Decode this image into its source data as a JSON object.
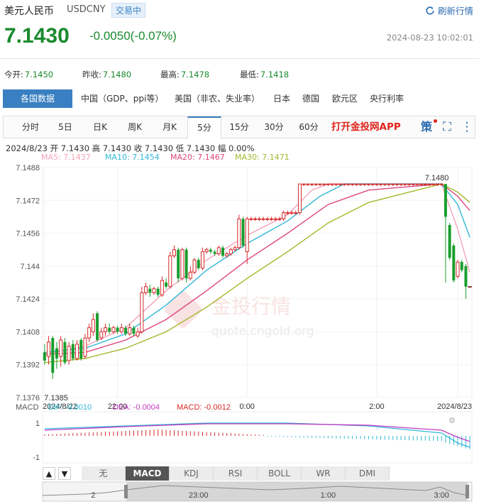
{
  "header": {
    "name": "美元人民币",
    "code": "USDCNY",
    "badge": "交易中",
    "refresh_label": "刷新行情",
    "price": "7.1430",
    "change": "-0.0050(-0.07%)",
    "time": "2024-08-23 10:02:01"
  },
  "stats": [
    {
      "label": "今开:",
      "value": "7.1450"
    },
    {
      "label": "昨收:",
      "value": "7.1480"
    },
    {
      "label": "最高:",
      "value": "7.1478"
    },
    {
      "label": "最低:",
      "value": "7.1418"
    }
  ],
  "categories": [
    "各国数据",
    "中国（GDP、ppi等）",
    "美国（非农、失业率）",
    "日本",
    "德国",
    "欧元区",
    "央行利率"
  ],
  "periods": [
    "分时",
    "5日",
    "日K",
    "周K",
    "月K",
    "5分",
    "15分",
    "30分",
    "60分"
  ],
  "active_period": "5分",
  "app_link": "打开金投网APP",
  "tools": {
    "ce": "策",
    "fullscreen": "⛶",
    "more": "⋮"
  },
  "bar_info": "2024/8/23  开 7.1430  高 7.1430  收 7.1430  低 7.1430  幅 0.00%",
  "ma_info": [
    {
      "label": "MA5: 7.1437",
      "color": "#f4a3b8"
    },
    {
      "label": "MA10: 7.1454",
      "color": "#2fb8d6"
    },
    {
      "label": "MA20: 7.1467",
      "color": "#e0457f"
    },
    {
      "label": "MA30: 7.1471",
      "color": "#a4b82a"
    }
  ],
  "watermark": {
    "brand": "金投行情",
    "url": "quote.cngold.org"
  },
  "colors": {
    "up": "#d42a2a",
    "down": "#1a9e2e",
    "accent": "#3a7fc1"
  },
  "chart_data": {
    "type": "candlestick",
    "y_ticks": [
      "7.1488",
      "7.1472",
      "7.1456",
      "7.144",
      "7.1424",
      "7.1408",
      "7.1392",
      "7.1376"
    ],
    "ylim": [
      7.1376,
      7.1488
    ],
    "x_ticks": [
      {
        "label": "2024/8/22",
        "index": 0
      },
      {
        "label": "22:00",
        "index": 18
      },
      {
        "label": "0:00",
        "index": 50
      },
      {
        "label": "2:00",
        "index": 82
      },
      {
        "label": "2024/8/23",
        "index": 102
      }
    ],
    "max_label": "7.1480",
    "min_label": "7.1385",
    "candles": [
      {
        "i": 0,
        "o": 7.1398,
        "c": 7.1394,
        "h": 7.1402,
        "l": 7.1392
      },
      {
        "i": 1,
        "o": 7.1396,
        "c": 7.1403,
        "h": 7.1406,
        "l": 7.1392
      },
      {
        "i": 2,
        "o": 7.1405,
        "c": 7.1388,
        "h": 7.1406,
        "l": 7.1385
      },
      {
        "i": 3,
        "o": 7.14,
        "c": 7.1395,
        "h": 7.1403,
        "l": 7.139
      },
      {
        "i": 4,
        "o": 7.1396,
        "c": 7.1404,
        "h": 7.1406,
        "l": 7.1391
      },
      {
        "i": 5,
        "o": 7.1403,
        "c": 7.1393,
        "h": 7.1405,
        "l": 7.1392
      },
      {
        "i": 6,
        "o": 7.1394,
        "c": 7.1401,
        "h": 7.1403,
        "l": 7.1392
      },
      {
        "i": 7,
        "o": 7.1402,
        "c": 7.1395,
        "h": 7.1404,
        "l": 7.1394
      },
      {
        "i": 8,
        "o": 7.1395,
        "c": 7.1402,
        "h": 7.1404,
        "l": 7.1394
      },
      {
        "i": 9,
        "o": 7.1404,
        "c": 7.1395,
        "h": 7.1405,
        "l": 7.1394
      },
      {
        "i": 10,
        "o": 7.1396,
        "c": 7.1405,
        "h": 7.1407,
        "l": 7.1395
      },
      {
        "i": 11,
        "o": 7.1405,
        "c": 7.141,
        "h": 7.1412,
        "l": 7.1403
      },
      {
        "i": 12,
        "o": 7.1408,
        "c": 7.1414,
        "h": 7.1417,
        "l": 7.1406
      },
      {
        "i": 13,
        "o": 7.1417,
        "c": 7.1404,
        "h": 7.1418,
        "l": 7.1403
      },
      {
        "i": 14,
        "o": 7.1405,
        "c": 7.1408,
        "h": 7.141,
        "l": 7.1404
      },
      {
        "i": 15,
        "o": 7.1408,
        "c": 7.141,
        "h": 7.1412,
        "l": 7.1406
      },
      {
        "i": 16,
        "o": 7.141,
        "c": 7.1408,
        "h": 7.1412,
        "l": 7.1407
      },
      {
        "i": 17,
        "o": 7.1408,
        "c": 7.141,
        "h": 7.1411,
        "l": 7.1407
      },
      {
        "i": 18,
        "o": 7.141,
        "c": 7.1408,
        "h": 7.1411,
        "l": 7.1407
      },
      {
        "i": 19,
        "o": 7.1408,
        "c": 7.141,
        "h": 7.1412,
        "l": 7.1407
      },
      {
        "i": 20,
        "o": 7.141,
        "c": 7.1407,
        "h": 7.1411,
        "l": 7.1406
      },
      {
        "i": 21,
        "o": 7.1407,
        "c": 7.141,
        "h": 7.1412,
        "l": 7.1406
      },
      {
        "i": 22,
        "o": 7.141,
        "c": 7.1407,
        "h": 7.1411,
        "l": 7.1406
      },
      {
        "i": 23,
        "o": 7.1406,
        "c": 7.1408,
        "h": 7.141,
        "l": 7.1405
      },
      {
        "i": 24,
        "o": 7.1408,
        "c": 7.1427,
        "h": 7.143,
        "l": 7.1407
      },
      {
        "i": 25,
        "o": 7.1427,
        "c": 7.143,
        "h": 7.1432,
        "l": 7.1426
      },
      {
        "i": 26,
        "o": 7.1429,
        "c": 7.1427,
        "h": 7.1431,
        "l": 7.1425
      },
      {
        "i": 27,
        "o": 7.1427,
        "c": 7.1429,
        "h": 7.143,
        "l": 7.1426
      },
      {
        "i": 28,
        "o": 7.1429,
        "c": 7.1426,
        "h": 7.143,
        "l": 7.1425
      },
      {
        "i": 29,
        "o": 7.1426,
        "c": 7.1433,
        "h": 7.1435,
        "l": 7.1425
      },
      {
        "i": 30,
        "o": 7.1432,
        "c": 7.143,
        "h": 7.1434,
        "l": 7.1429
      },
      {
        "i": 31,
        "o": 7.143,
        "c": 7.1445,
        "h": 7.1447,
        "l": 7.1429
      },
      {
        "i": 32,
        "o": 7.1445,
        "c": 7.1448,
        "h": 7.145,
        "l": 7.1444
      },
      {
        "i": 33,
        "o": 7.1448,
        "c": 7.1434,
        "h": 7.1449,
        "l": 7.1432
      },
      {
        "i": 34,
        "o": 7.1434,
        "c": 7.1448,
        "h": 7.1449,
        "l": 7.1433
      },
      {
        "i": 35,
        "o": 7.1448,
        "c": 7.1434,
        "h": 7.1449,
        "l": 7.1432
      },
      {
        "i": 36,
        "o": 7.1434,
        "c": 7.1437,
        "h": 7.144,
        "l": 7.1433
      },
      {
        "i": 37,
        "o": 7.1437,
        "c": 7.1443,
        "h": 7.1444,
        "l": 7.1436
      },
      {
        "i": 38,
        "o": 7.1443,
        "c": 7.1439,
        "h": 7.1444,
        "l": 7.1438
      },
      {
        "i": 39,
        "o": 7.1439,
        "c": 7.1447,
        "h": 7.1449,
        "l": 7.1438
      },
      {
        "i": 40,
        "o": 7.1447,
        "c": 7.1448,
        "h": 7.1449,
        "l": 7.1446
      },
      {
        "i": 41,
        "o": 7.1448,
        "c": 7.1447,
        "h": 7.1449,
        "l": 7.1446
      },
      {
        "i": 42,
        "o": 7.1447,
        "c": 7.1446,
        "h": 7.1448,
        "l": 7.1445
      },
      {
        "i": 43,
        "o": 7.1446,
        "c": 7.1449,
        "h": 7.145,
        "l": 7.1445
      },
      {
        "i": 44,
        "o": 7.1449,
        "c": 7.1445,
        "h": 7.145,
        "l": 7.1444
      },
      {
        "i": 45,
        "o": 7.1445,
        "c": 7.1446,
        "h": 7.1447,
        "l": 7.1444
      },
      {
        "i": 46,
        "o": 7.1446,
        "c": 7.1448,
        "h": 7.1449,
        "l": 7.1445
      },
      {
        "i": 47,
        "o": 7.1448,
        "c": 7.1449,
        "h": 7.145,
        "l": 7.1447
      },
      {
        "i": 48,
        "o": 7.1449,
        "c": 7.1463,
        "h": 7.1465,
        "l": 7.1448
      },
      {
        "i": 49,
        "o": 7.1463,
        "c": 7.145,
        "h": 7.1464,
        "l": 7.1449
      },
      {
        "i": 50,
        "o": 7.1447,
        "c": 7.1463,
        "h": 7.1464,
        "l": 7.1441
      },
      {
        "i": 51,
        "o": 7.1463,
        "c": 7.1463,
        "h": 7.1464,
        "l": 7.1462
      },
      {
        "i": 52,
        "o": 7.1463,
        "c": 7.1463,
        "h": 7.1464,
        "l": 7.1462
      },
      {
        "i": 53,
        "o": 7.1463,
        "c": 7.1463,
        "h": 7.1464,
        "l": 7.1462
      },
      {
        "i": 54,
        "o": 7.1463,
        "c": 7.1463,
        "h": 7.1464,
        "l": 7.1462
      },
      {
        "i": 55,
        "o": 7.1463,
        "c": 7.1463,
        "h": 7.1464,
        "l": 7.1462
      },
      {
        "i": 56,
        "o": 7.1463,
        "c": 7.1463,
        "h": 7.1464,
        "l": 7.1462
      },
      {
        "i": 57,
        "o": 7.1463,
        "c": 7.1463,
        "h": 7.1464,
        "l": 7.1462
      },
      {
        "i": 58,
        "o": 7.1463,
        "c": 7.1463,
        "h": 7.1464,
        "l": 7.1462
      },
      {
        "i": 59,
        "o": 7.1463,
        "c": 7.1466,
        "h": 7.1467,
        "l": 7.1462
      },
      {
        "i": 60,
        "o": 7.1466,
        "c": 7.1466,
        "h": 7.1467,
        "l": 7.1465
      },
      {
        "i": 61,
        "o": 7.1466,
        "c": 7.1466,
        "h": 7.1467,
        "l": 7.1465
      },
      {
        "i": 62,
        "o": 7.1466,
        "c": 7.1466,
        "h": 7.1467,
        "l": 7.1465
      },
      {
        "i": 63,
        "o": 7.1466,
        "c": 7.148,
        "h": 7.148,
        "l": 7.1465
      },
      {
        "i": 64,
        "o": 7.148,
        "c": 7.148,
        "h": 7.148,
        "l": 7.1479
      },
      {
        "i": 65,
        "o": 7.148,
        "c": 7.148,
        "h": 7.148,
        "l": 7.1479
      },
      {
        "i": 66,
        "o": 7.148,
        "c": 7.148,
        "h": 7.148,
        "l": 7.1479
      },
      {
        "i": 67,
        "o": 7.148,
        "c": 7.148,
        "h": 7.148,
        "l": 7.1479
      },
      {
        "i": 68,
        "o": 7.148,
        "c": 7.148,
        "h": 7.148,
        "l": 7.1479
      },
      {
        "i": 69,
        "o": 7.148,
        "c": 7.148,
        "h": 7.148,
        "l": 7.1479
      },
      {
        "i": 70,
        "o": 7.148,
        "c": 7.148,
        "h": 7.148,
        "l": 7.1479
      },
      {
        "i": 71,
        "o": 7.148,
        "c": 7.148,
        "h": 7.148,
        "l": 7.1479
      },
      {
        "i": 72,
        "o": 7.148,
        "c": 7.148,
        "h": 7.148,
        "l": 7.1479
      },
      {
        "i": 73,
        "o": 7.148,
        "c": 7.148,
        "h": 7.148,
        "l": 7.1479
      },
      {
        "i": 74,
        "o": 7.148,
        "c": 7.148,
        "h": 7.148,
        "l": 7.1479
      },
      {
        "i": 75,
        "o": 7.148,
        "c": 7.148,
        "h": 7.148,
        "l": 7.1479
      },
      {
        "i": 76,
        "o": 7.148,
        "c": 7.148,
        "h": 7.148,
        "l": 7.1479
      },
      {
        "i": 77,
        "o": 7.148,
        "c": 7.148,
        "h": 7.148,
        "l": 7.1479
      },
      {
        "i": 78,
        "o": 7.148,
        "c": 7.148,
        "h": 7.148,
        "l": 7.1479
      },
      {
        "i": 79,
        "o": 7.148,
        "c": 7.148,
        "h": 7.148,
        "l": 7.1479
      },
      {
        "i": 80,
        "o": 7.148,
        "c": 7.148,
        "h": 7.148,
        "l": 7.1479
      },
      {
        "i": 81,
        "o": 7.148,
        "c": 7.148,
        "h": 7.148,
        "l": 7.1479
      },
      {
        "i": 82,
        "o": 7.148,
        "c": 7.148,
        "h": 7.148,
        "l": 7.1479
      },
      {
        "i": 83,
        "o": 7.148,
        "c": 7.148,
        "h": 7.148,
        "l": 7.1479
      },
      {
        "i": 84,
        "o": 7.148,
        "c": 7.148,
        "h": 7.148,
        "l": 7.1479
      },
      {
        "i": 85,
        "o": 7.148,
        "c": 7.148,
        "h": 7.148,
        "l": 7.1479
      },
      {
        "i": 86,
        "o": 7.148,
        "c": 7.148,
        "h": 7.148,
        "l": 7.1479
      },
      {
        "i": 87,
        "o": 7.148,
        "c": 7.148,
        "h": 7.148,
        "l": 7.1479
      },
      {
        "i": 88,
        "o": 7.148,
        "c": 7.148,
        "h": 7.148,
        "l": 7.1479
      },
      {
        "i": 89,
        "o": 7.148,
        "c": 7.148,
        "h": 7.148,
        "l": 7.1479
      },
      {
        "i": 90,
        "o": 7.148,
        "c": 7.148,
        "h": 7.148,
        "l": 7.1479
      },
      {
        "i": 91,
        "o": 7.148,
        "c": 7.148,
        "h": 7.148,
        "l": 7.1479
      },
      {
        "i": 92,
        "o": 7.148,
        "c": 7.148,
        "h": 7.148,
        "l": 7.1479
      },
      {
        "i": 93,
        "o": 7.148,
        "c": 7.148,
        "h": 7.148,
        "l": 7.1479
      },
      {
        "i": 94,
        "o": 7.148,
        "c": 7.148,
        "h": 7.148,
        "l": 7.1479
      },
      {
        "i": 95,
        "o": 7.148,
        "c": 7.148,
        "h": 7.148,
        "l": 7.1479
      },
      {
        "i": 96,
        "o": 7.148,
        "c": 7.148,
        "h": 7.148,
        "l": 7.1479
      },
      {
        "i": 97,
        "o": 7.148,
        "c": 7.148,
        "h": 7.148,
        "l": 7.1479
      },
      {
        "i": 98,
        "o": 7.148,
        "c": 7.148,
        "h": 7.148,
        "l": 7.1479
      },
      {
        "i": 99,
        "o": 7.148,
        "c": 7.1464,
        "h": 7.148,
        "l": 7.1432
      },
      {
        "i": 100,
        "o": 7.146,
        "c": 7.1444,
        "h": 7.1461,
        "l": 7.1443
      },
      {
        "i": 101,
        "o": 7.145,
        "c": 7.1433,
        "h": 7.1451,
        "l": 7.1432
      },
      {
        "i": 102,
        "o": 7.1435,
        "c": 7.1442,
        "h": 7.1443,
        "l": 7.1434
      },
      {
        "i": 103,
        "o": 7.1442,
        "c": 7.1438,
        "h": 7.1443,
        "l": 7.1437
      },
      {
        "i": 104,
        "o": 7.144,
        "c": 7.143,
        "h": 7.1441,
        "l": 7.1424
      },
      {
        "i": 105,
        "o": 7.143,
        "c": 7.143,
        "h": 7.143,
        "l": 7.143
      }
    ],
    "ma_series": [
      {
        "name": "MA5",
        "color": "#f4a3b8",
        "points": [
          [
            0,
            7.1397
          ],
          [
            10,
            7.1401
          ],
          [
            20,
            7.141
          ],
          [
            30,
            7.1428
          ],
          [
            40,
            7.1443
          ],
          [
            50,
            7.1455
          ],
          [
            60,
            7.1465
          ],
          [
            66,
            7.1477
          ],
          [
            70,
            7.148
          ],
          [
            98,
            7.148
          ],
          [
            102,
            7.1458
          ],
          [
            105,
            7.1437
          ]
        ]
      },
      {
        "name": "MA10",
        "color": "#2fb8d6",
        "points": [
          [
            0,
            7.1398
          ],
          [
            10,
            7.14
          ],
          [
            20,
            7.1407
          ],
          [
            30,
            7.1421
          ],
          [
            40,
            7.1438
          ],
          [
            50,
            7.1451
          ],
          [
            60,
            7.1462
          ],
          [
            68,
            7.1474
          ],
          [
            74,
            7.148
          ],
          [
            98,
            7.148
          ],
          [
            102,
            7.147
          ],
          [
            105,
            7.1454
          ]
        ]
      },
      {
        "name": "MA20",
        "color": "#e0457f",
        "points": [
          [
            0,
            7.1397
          ],
          [
            10,
            7.1398
          ],
          [
            20,
            7.1404
          ],
          [
            30,
            7.1414
          ],
          [
            40,
            7.1428
          ],
          [
            50,
            7.1443
          ],
          [
            60,
            7.1456
          ],
          [
            70,
            7.147
          ],
          [
            80,
            7.1477
          ],
          [
            98,
            7.148
          ],
          [
            102,
            7.1474
          ],
          [
            105,
            7.1467
          ]
        ]
      },
      {
        "name": "MA30",
        "color": "#a4b82a",
        "points": [
          [
            0,
            7.1393
          ],
          [
            10,
            7.1395
          ],
          [
            20,
            7.14
          ],
          [
            30,
            7.1408
          ],
          [
            40,
            7.142
          ],
          [
            50,
            7.1434
          ],
          [
            60,
            7.1447
          ],
          [
            70,
            7.1461
          ],
          [
            80,
            7.1471
          ],
          [
            90,
            7.1476
          ],
          [
            98,
            7.148
          ],
          [
            102,
            7.1476
          ],
          [
            105,
            7.1471
          ]
        ]
      }
    ],
    "macd": {
      "label": "MACD",
      "dif": "DIF: -0.0010",
      "dea": "DEA: -0.0004",
      "macd": "MACD: -0.0012",
      "y_ticks": [
        "1",
        "-1"
      ]
    },
    "indicator_tabs": [
      "无",
      "MACD",
      "KDJ",
      "RSI",
      "BOLL",
      "WR",
      "DMI"
    ],
    "active_indicator": "MACD",
    "navigator_ticks": [
      {
        "label": "2",
        "index": 12
      },
      {
        "label": "23:00",
        "index": 38
      },
      {
        "label": "1:00",
        "index": 70
      },
      {
        "label": "3:00",
        "index": 98
      }
    ]
  }
}
